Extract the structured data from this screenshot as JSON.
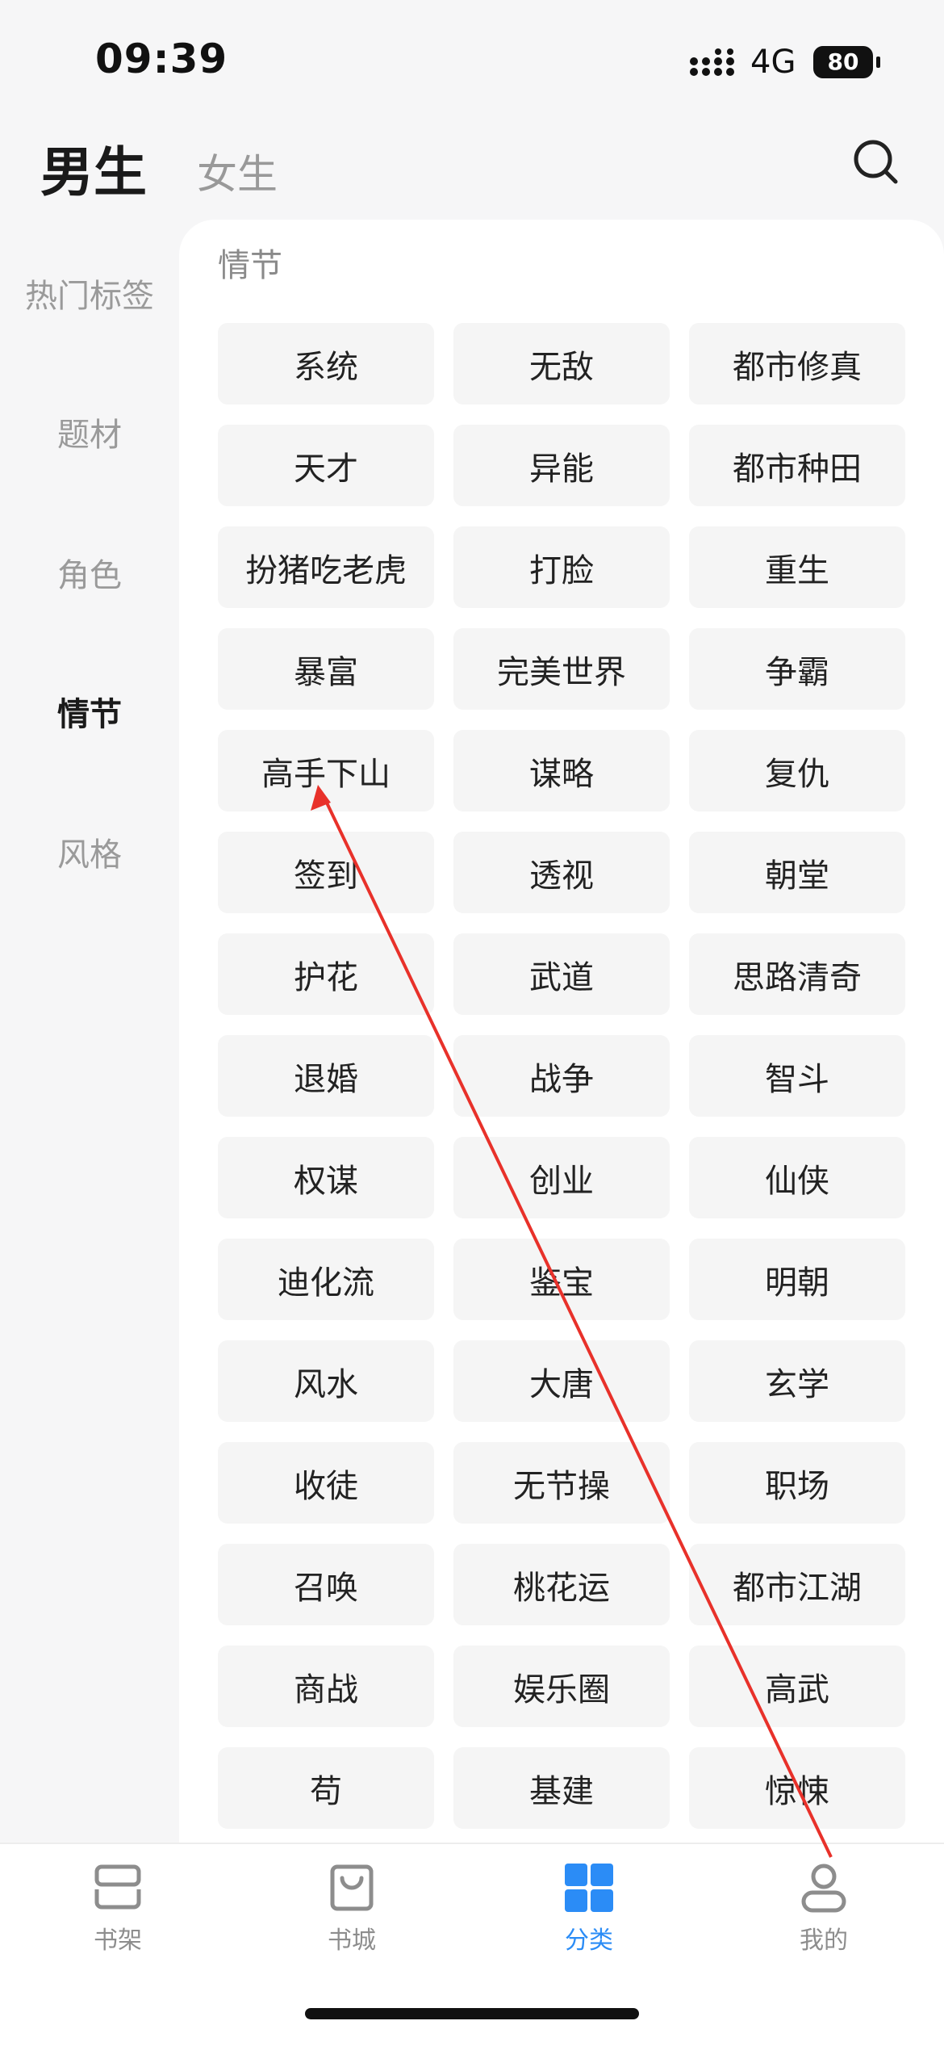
{
  "status_bar": {
    "time": "09:39",
    "network": "4G",
    "battery": "80"
  },
  "header": {
    "tab_male": "男生",
    "tab_female": "女生",
    "search_icon": "search-icon"
  },
  "sidebar": {
    "items": [
      "热门标签",
      "题材",
      "角色",
      "情节",
      "风格"
    ],
    "active": "情节"
  },
  "main": {
    "section_title": "情节",
    "tags": [
      "系统",
      "无敌",
      "都市修真",
      "天才",
      "异能",
      "都市种田",
      "扮猪吃老虎",
      "打脸",
      "重生",
      "暴富",
      "完美世界",
      "争霸",
      "高手下山",
      "谋略",
      "复仇",
      "签到",
      "透视",
      "朝堂",
      "护花",
      "武道",
      "思路清奇",
      "退婚",
      "战争",
      "智斗",
      "权谋",
      "创业",
      "仙侠",
      "迪化流",
      "鉴宝",
      "明朝",
      "风水",
      "大唐",
      "玄学",
      "收徒",
      "无节操",
      "职场",
      "召唤",
      "桃花运",
      "都市江湖",
      "商战",
      "娱乐圈",
      "高武",
      "苟",
      "基建",
      "惊悚"
    ]
  },
  "bottom_nav": {
    "items": [
      {
        "label": "书架",
        "icon": "bookshelf-icon"
      },
      {
        "label": "书城",
        "icon": "bookstore-bag-icon"
      },
      {
        "label": "分类",
        "icon": "category-grid-icon"
      },
      {
        "label": "我的",
        "icon": "profile-icon"
      }
    ],
    "active": "分类"
  },
  "colors": {
    "accent": "#2b8cf6",
    "annotation_arrow": "#e8312a"
  }
}
